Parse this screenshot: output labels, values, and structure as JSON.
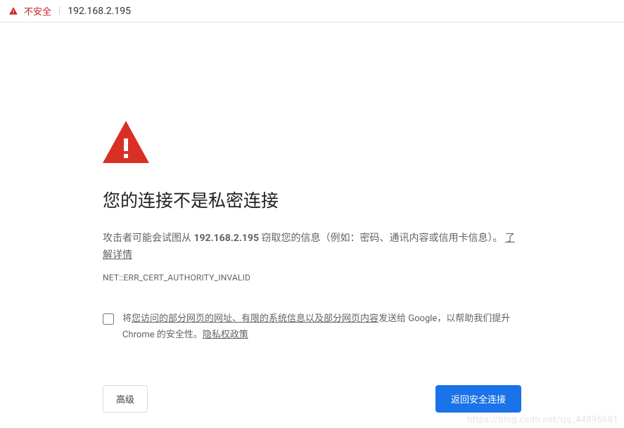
{
  "address_bar": {
    "security_label": "不安全",
    "url": "192.168.2.195"
  },
  "page": {
    "heading": "您的连接不是私密连接",
    "warning_prefix": "攻击者可能会试图从 ",
    "warning_ip": "192.168.2.195",
    "warning_suffix": " 窃取您的信息（例如：密码、通讯内容或信用卡信息）。",
    "learn_more": "了解详情",
    "error_code": "NET::ERR_CERT_AUTHORITY_INVALID",
    "optin_prefix": "将",
    "optin_link1": "您访问的部分网页的网址、有限的系统信息以及部分网页内容",
    "optin_middle": "发送给 Google，以帮助我们提升 Chrome 的安全性。",
    "optin_privacy": "隐私权政策",
    "advanced_btn": "高级",
    "back_btn": "返回安全连接"
  },
  "watermark": "https://blog.csdn.net/qq_44895681"
}
